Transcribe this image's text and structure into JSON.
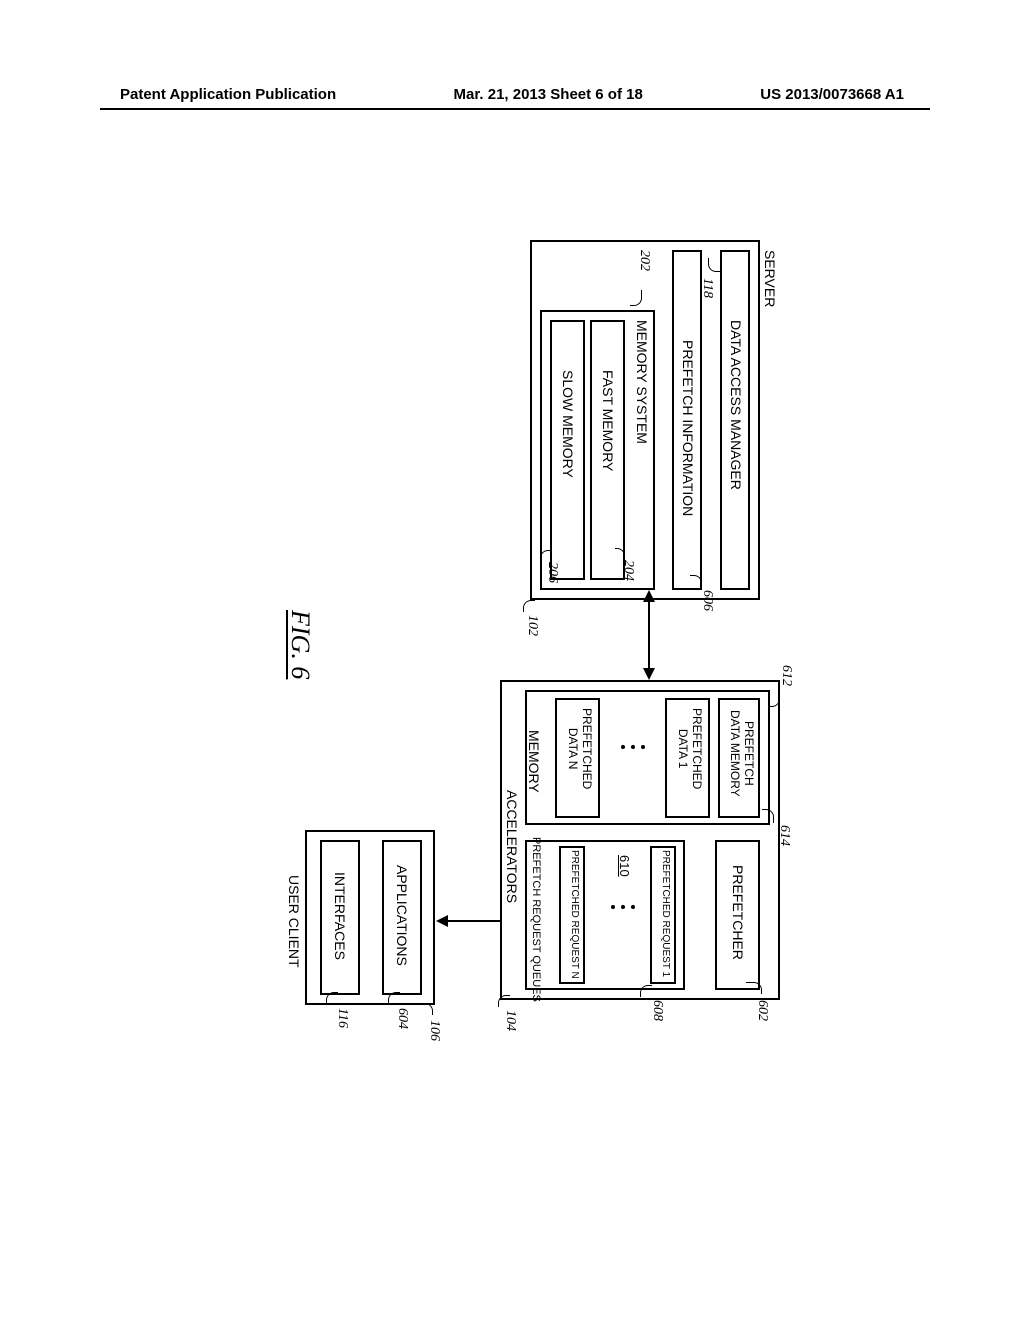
{
  "header": {
    "left": "Patent Application Publication",
    "center": "Mar. 21, 2013  Sheet 6 of 18",
    "right": "US 2013/0073668 A1"
  },
  "figure_label": "FIG. 6",
  "server": {
    "title": "SERVER",
    "ref": "102",
    "data_access_manager": {
      "label": "DATA ACCESS MANAGER",
      "ref": "118"
    },
    "prefetch_info": {
      "label": "PREFETCH INFORMATION",
      "ref": "606"
    },
    "memory_system": {
      "label": "MEMORY SYSTEM",
      "ref": "202",
      "fast": {
        "label": "FAST MEMORY",
        "ref": "204"
      },
      "slow": {
        "label": "SLOW MEMORY",
        "ref": "206"
      }
    }
  },
  "accelerators": {
    "title": "ACCELERATORS",
    "ref": "104",
    "memory": {
      "label": "MEMORY",
      "ref": "612",
      "prefetch_data_memory": {
        "label": "PREFETCH\nDATA MEMORY",
        "ref": "614"
      },
      "data1": {
        "label": "PREFETCHED\nDATA 1"
      },
      "datan": {
        "label": "PREFETCHED\nDATA N"
      }
    },
    "prefetcher": {
      "label": "PREFETCHER",
      "ref": "602"
    },
    "queues": {
      "label": "PREFETCH REQUEST QUEUES",
      "ref_container": "608",
      "req1": {
        "label": "PREFETCHED REQUEST 1"
      },
      "reqn": {
        "label": "PREFETCHED REQUEST N"
      },
      "ref_item": "610"
    }
  },
  "user_client": {
    "title": "USER CLIENT",
    "ref": "106",
    "applications": {
      "label": "APPLICATIONS",
      "ref": "604"
    },
    "interfaces": {
      "label": "INTERFACES",
      "ref": "116"
    }
  }
}
